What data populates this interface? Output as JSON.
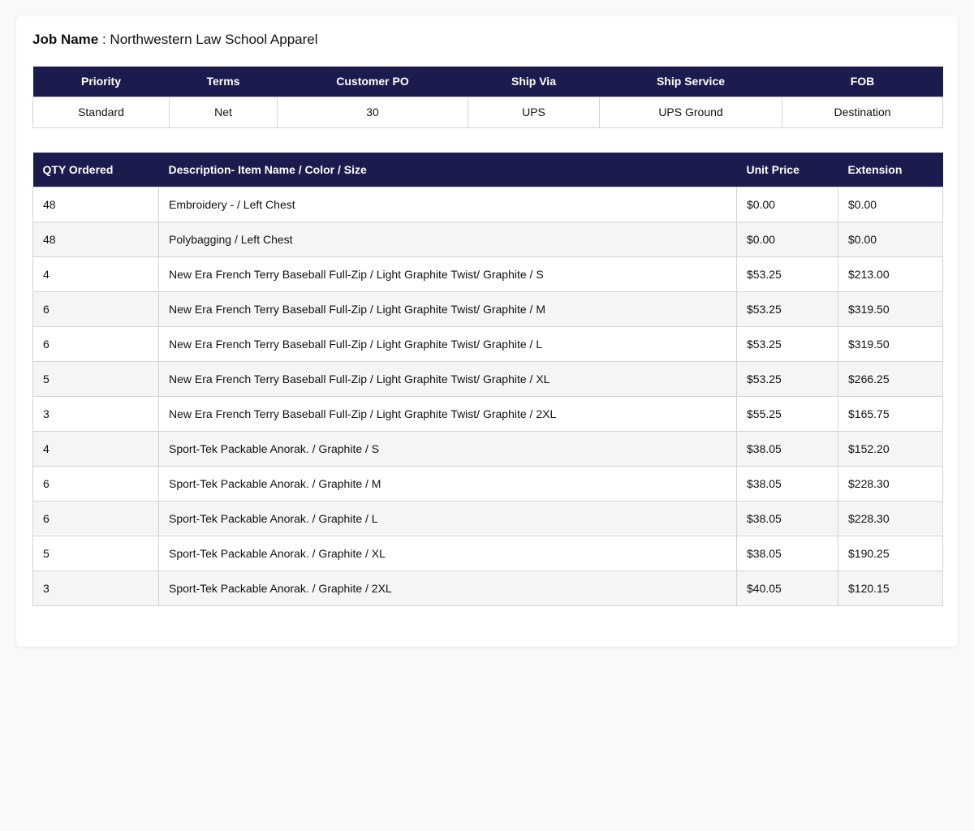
{
  "job": {
    "label": "Job Name",
    "separator": " : ",
    "value": "Northwestern Law School Apparel"
  },
  "info_table": {
    "headers": [
      "Priority",
      "Terms",
      "Customer PO",
      "Ship Via",
      "Ship Service",
      "FOB"
    ],
    "values": [
      "Standard",
      "Net",
      "30",
      "UPS",
      "UPS Ground",
      "Destination"
    ]
  },
  "items_table": {
    "headers": [
      "QTY Ordered",
      "Description- Item Name / Color / Size",
      "Unit Price",
      "Extension"
    ],
    "rows": [
      [
        "48",
        "Embroidery - / Left Chest",
        "$0.00",
        "$0.00"
      ],
      [
        "48",
        "Polybagging / Left Chest",
        "$0.00",
        "$0.00"
      ],
      [
        "4",
        "New Era French Terry Baseball Full-Zip / Light Graphite Twist/ Graphite / S",
        "$53.25",
        "$213.00"
      ],
      [
        "6",
        "New Era French Terry Baseball Full-Zip / Light Graphite Twist/ Graphite / M",
        "$53.25",
        "$319.50"
      ],
      [
        "6",
        "New Era French Terry Baseball Full-Zip / Light Graphite Twist/ Graphite / L",
        "$53.25",
        "$319.50"
      ],
      [
        "5",
        "New Era French Terry Baseball Full-Zip / Light Graphite Twist/ Graphite / XL",
        "$53.25",
        "$266.25"
      ],
      [
        "3",
        "New Era French Terry Baseball Full-Zip / Light Graphite Twist/ Graphite / 2XL",
        "$55.25",
        "$165.75"
      ],
      [
        "4",
        "Sport-Tek Packable Anorak. / Graphite / S",
        "$38.05",
        "$152.20"
      ],
      [
        "6",
        "Sport-Tek Packable Anorak. / Graphite / M",
        "$38.05",
        "$228.30"
      ],
      [
        "6",
        "Sport-Tek Packable Anorak. / Graphite / L",
        "$38.05",
        "$228.30"
      ],
      [
        "5",
        "Sport-Tek Packable Anorak. / Graphite / XL",
        "$38.05",
        "$190.25"
      ],
      [
        "3",
        "Sport-Tek Packable Anorak. / Graphite / 2XL",
        "$40.05",
        "$120.15"
      ]
    ]
  },
  "colors": {
    "header_bg": "#1b1b4d",
    "header_text": "#ffffff",
    "alt_row_bg": "#f5f5f5",
    "border": "#d4d4d4"
  }
}
